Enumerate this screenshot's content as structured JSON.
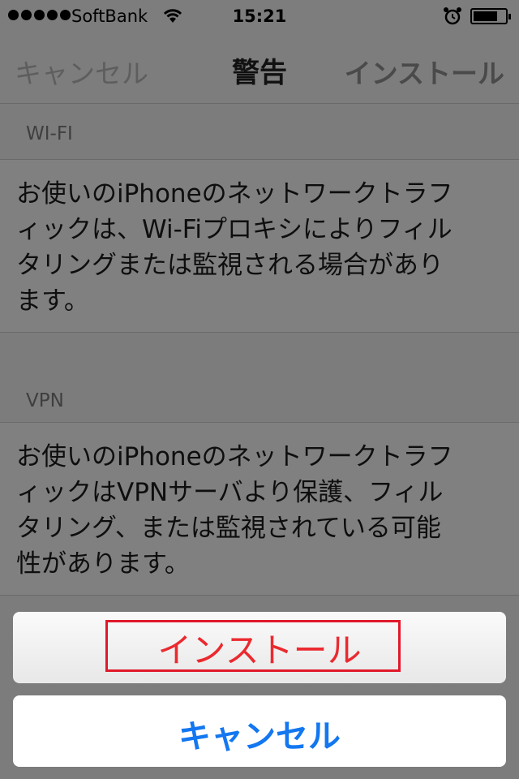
{
  "status_bar": {
    "carrier": "SoftBank",
    "time": "15:21",
    "icons": [
      "signal-dots",
      "wifi-icon",
      "alarm-icon",
      "battery-icon"
    ]
  },
  "nav": {
    "cancel_label": "キャンセル",
    "title": "警告",
    "install_label": "インストール"
  },
  "sections": [
    {
      "header": "WI-FI",
      "body": "お使いのiPhoneのネットワークトラフ\nィックは、Wi-Fiプロキシによりフィル\nタリングまたは監視される場合があり\nます。"
    },
    {
      "header": "VPN",
      "body": "お使いのiPhoneのネットワークトラフ\nィックはVPNサーバより保護、フィル\nタリング、または監視されている可能\n性があります。"
    }
  ],
  "action_sheet": {
    "install_label": "インストール",
    "cancel_label": "キャンセル"
  },
  "colors": {
    "install_text": "#ea2a2f",
    "highlight_box": "#e0192b",
    "cancel_text": "#1377f0"
  }
}
